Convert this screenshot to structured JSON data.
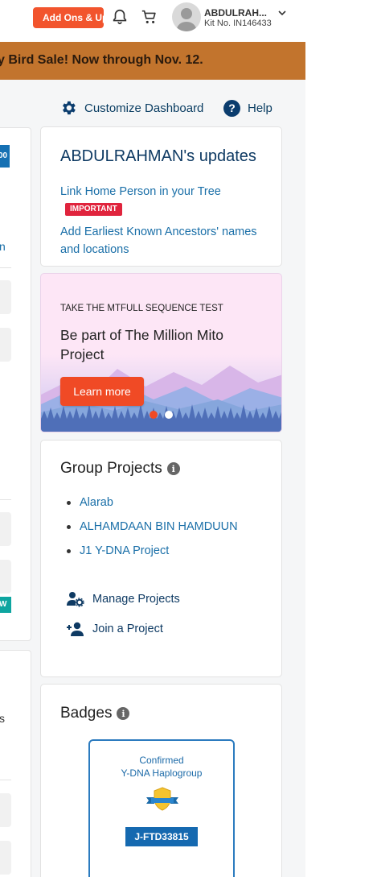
{
  "header": {
    "addons_label": "Add Ons & Upgrades",
    "user_name": "ABDULRAH...",
    "kit_number": "Kit No. IN146433"
  },
  "banner": {
    "text": "y Bird Sale! Now through Nov. 12."
  },
  "toolbar": {
    "customize_label": "Customize Dashboard",
    "help_label": "Help"
  },
  "updates": {
    "title": "ABDULRAHMAN's updates",
    "item1": "Link Home Person in your Tree",
    "item1_badge": "IMPORTANT",
    "item2": "Add Earliest Known Ancestors' names and locations"
  },
  "promo": {
    "eyebrow": "TAKE THE MTFULL SEQUENCE TEST",
    "headline": "Be part of The Million Mito Project",
    "button": "Learn more"
  },
  "groups": {
    "title": "Group Projects",
    "items": [
      "Alarab",
      "ALHAMDAAN BIN HAMDUUN",
      "J1 Y-DNA Project"
    ],
    "manage_label": "Manage Projects",
    "join_label": "Join a Project"
  },
  "badges": {
    "title": "Badges",
    "line1": "Confirmed",
    "line2": "Y-DNA Haplogroup",
    "haplogroup": "J-FTD33815"
  },
  "left_fragments": {
    "badge_num": "00",
    "letter_n": "n",
    "badge_w": "W",
    "letter_s": "s"
  },
  "colors": {
    "accent_orange": "#f2542d",
    "banner_brown": "#c2742d",
    "navy": "#0e3a63",
    "link_blue": "#1a6fa8",
    "important_red": "#e0243d",
    "promo_pink": "#fde6f6"
  }
}
